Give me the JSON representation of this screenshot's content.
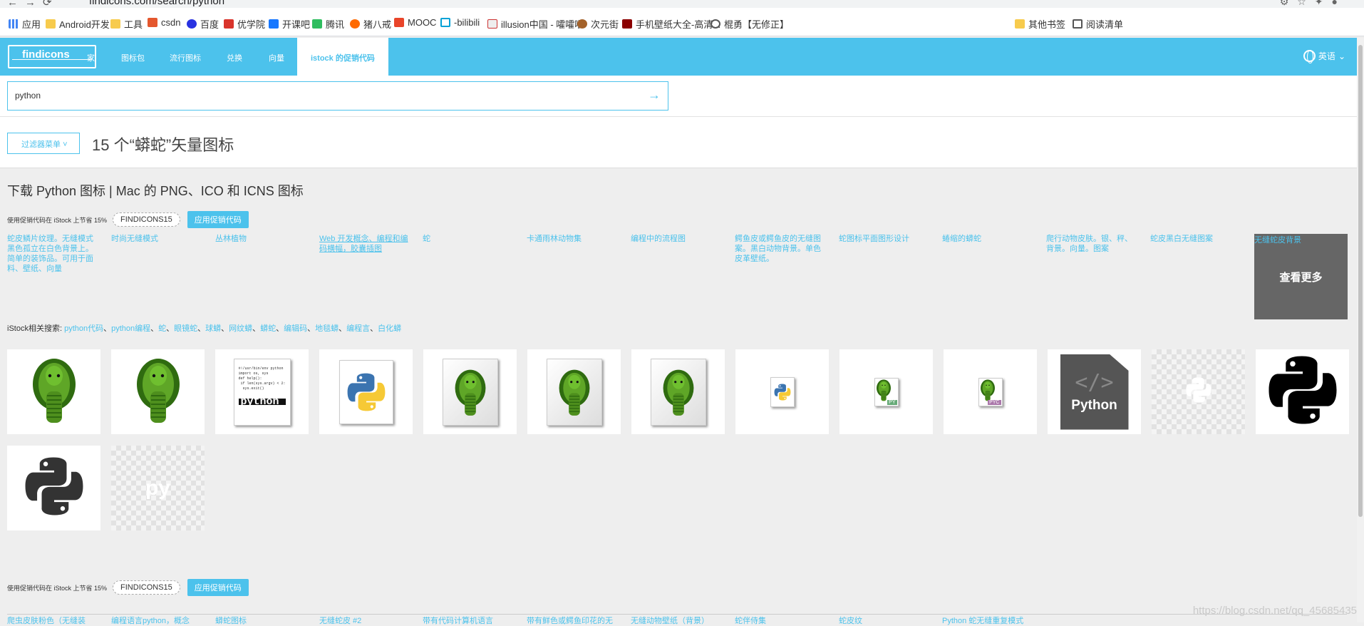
{
  "browser": {
    "url": "findicons.com/search/python",
    "bookmarks": [
      "应用",
      "Android开发",
      "工具",
      "csdn",
      "百度",
      "优学院",
      "开课吧",
      "腾讯",
      "猪八戒",
      "MOOC",
      "-bilibili",
      "illusion中国 - 嚯嚯嚯",
      "次元街",
      "手机壁纸大全-高清...",
      "棍勇【无修正】",
      "其他书签",
      "阅读清单"
    ]
  },
  "header": {
    "logo": "findicons",
    "nav": [
      "家",
      "图标包",
      "流行图标",
      "兑换",
      "向量",
      "istock 的促销代码"
    ],
    "language": "英语"
  },
  "search": {
    "value": "python"
  },
  "filter_label": "过滤器菜单",
  "page_title": "15 个“蟒蛇”矢量图标",
  "download_heading": "下载 Python 图标 | Mac 的 PNG、ICO 和 ICNS 图标",
  "promo": {
    "text": "使用促销代码在 iStock 上节省 15%",
    "code": "FINDICONS15",
    "apply": "应用促销代码"
  },
  "stock_images": [
    "蛇皮鳞片纹理。无缝模式黑色孤立在白色背景上。简单的装饰品。可用于面料、壁纸、向量",
    "时尚无缝模式",
    "丛林植物",
    "Web 开发概念、编程和编码横幅，胶囊插图",
    "蛇",
    "卡通雨林动物集",
    "编程中的流程图",
    "鳄鱼皮或鳄鱼皮的无缝图案。黑白动物背景。单色皮革壁纸。",
    "蛇图标平面图形设计",
    "蜷缩的蟒蛇",
    "爬行动物皮肤。银、秤、背景。向量。图案",
    "蛇皮黑白无缝图案"
  ],
  "see_more": {
    "caption": "无缝蛇皮背景",
    "label": "查看更多"
  },
  "related": {
    "label": "iStock相关搜索:",
    "items": [
      "python代码",
      "python编程",
      "蛇",
      "眼镜蛇",
      "球蟒",
      "网纹蟒",
      "蟒蛇",
      "编辑码",
      "地毯蟒",
      "编程言",
      "白化蟒"
    ]
  },
  "icon_tiles": [
    {
      "name": "green-snake-icon"
    },
    {
      "name": "green-snake-icon"
    },
    {
      "name": "python-source-file-icon",
      "text": "python"
    },
    {
      "name": "python-logo-file-icon"
    },
    {
      "name": "snake-file-icon"
    },
    {
      "name": "snake-file-icon"
    },
    {
      "name": "snake-file-icon"
    },
    {
      "name": "python-small-file-icon"
    },
    {
      "name": "py-file-icon",
      "text": "PY"
    },
    {
      "name": "pyc-file-icon",
      "text": "PYC"
    },
    {
      "name": "python-code-file-icon",
      "text": "Python"
    },
    {
      "name": "python-white-logo-icon"
    },
    {
      "name": "python-black-logo-icon"
    },
    {
      "name": "python-dark-logo-icon"
    },
    {
      "name": "py-text-icon",
      "text": "py"
    }
  ],
  "bottom_stock": [
    "爬虫皮肤粉色（无缝装",
    "编程语言python，概念",
    "蟒蛇图标",
    "无缝蛇皮 #2",
    "带有代码计算机语言",
    "带有鲜色或鳄鱼印花的无",
    "无缝动物壁纸（背景）",
    "蛇伴侍集",
    "蛇皮纹",
    "Python 蛇无缝重复模式"
  ],
  "watermark": "https://blog.csdn.net/qq_45685435",
  "colors": {
    "accent": "#4cc2ec",
    "snake_green": "#3d7a15"
  }
}
